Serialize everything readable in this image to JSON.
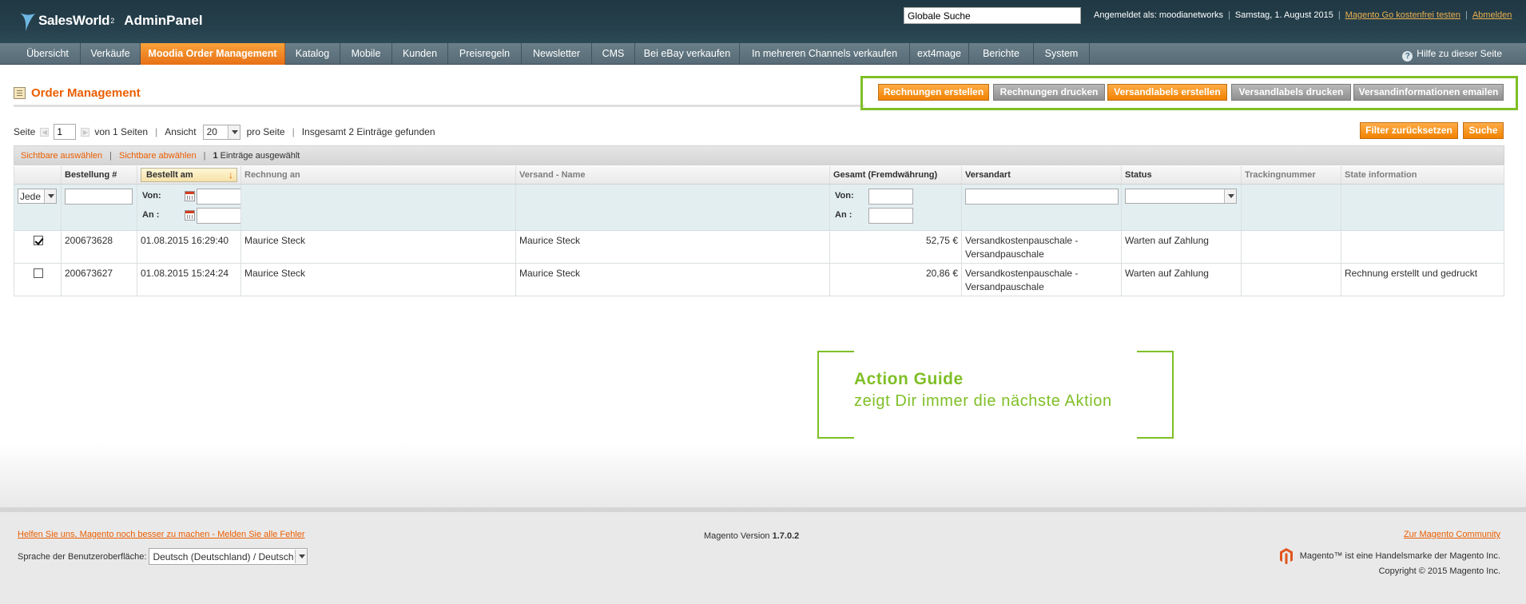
{
  "header": {
    "brand": "SalesWorld",
    "brand_sup": "2",
    "panel": "AdminPanel",
    "search_value": "Globale Suche",
    "logged_in": "Angemeldet als: moodianetworks",
    "date": "Samstag, 1. August 2015",
    "trial_link": "Magento Go kostenfrei testen",
    "logout": "Abmelden"
  },
  "nav": {
    "items": [
      "Übersicht",
      "Verkäufe",
      "Moodia Order Management",
      "Katalog",
      "Mobile",
      "Kunden",
      "Preisregeln",
      "Newsletter",
      "CMS",
      "Bei eBay verkaufen",
      "In mehreren Channels verkaufen",
      "ext4mage",
      "Berichte",
      "System"
    ],
    "active": "Moodia Order Management",
    "help": "Hilfe zu dieser Seite"
  },
  "page": {
    "title": "Order Management"
  },
  "actions": {
    "create_invoices": "Rechnungen erstellen",
    "print_invoices": "Rechnungen drucken",
    "create_labels": "Versandlabels erstellen",
    "print_labels": "Versandlabels drucken",
    "email_shipping": "Versandinformationen emailen"
  },
  "pager": {
    "page_label": "Seite",
    "page_value": "1",
    "of_pages": "von 1 Seiten",
    "view_label": "Ansicht",
    "per_page": "20",
    "per_page_label": "pro Seite",
    "total": "Insgesamt 2 Einträge gefunden",
    "reset_filter": "Filter zurücksetzen",
    "search": "Suche"
  },
  "massaction": {
    "select_visible": "Sichtbare auswählen",
    "unselect_visible": "Sichtbare abwählen",
    "selected_count": "1",
    "selected_label": "Einträge ausgewählt"
  },
  "grid": {
    "headers": {
      "order": "Bestellung #",
      "ordered_at": "Bestellt am",
      "bill_to": "Rechnung an",
      "ship_to": "Versand - Name",
      "total": "Gesamt (Fremdwährung)",
      "shipping": "Versandart",
      "status": "Status",
      "tracking": "Trackingnummer",
      "state": "State information"
    },
    "filters": {
      "any": "Jede",
      "from": "Von:",
      "to": "An :"
    },
    "rows": [
      {
        "checked": true,
        "order": "200673628",
        "ordered_at": "01.08.2015 16:29:40",
        "bill_to": "Maurice Steck",
        "ship_to": "Maurice Steck",
        "total": "52,75 €",
        "shipping": "Versandkostenpauschale - Versandpauschale",
        "status": "Warten auf Zahlung",
        "tracking": "",
        "state": ""
      },
      {
        "checked": false,
        "order": "200673627",
        "ordered_at": "01.08.2015 15:24:24",
        "bill_to": "Maurice Steck",
        "ship_to": "Maurice Steck",
        "total": "20,86 €",
        "shipping": "Versandkostenpauschale - Versandpauschale",
        "status": "Warten auf Zahlung",
        "tracking": "",
        "state": "Rechnung erstellt und gedruckt"
      }
    ]
  },
  "guide": {
    "title": "Action Guide",
    "subtitle": "zeigt Dir immer die nächste Aktion"
  },
  "footer": {
    "feedback_link": "Helfen Sie uns, Magento noch besser zu machen - Melden Sie alle Fehler",
    "language_label": "Sprache der Benutzeroberfläche:",
    "language_value": "Deutsch (Deutschland) / Deutsch",
    "version_label": "Magento Version",
    "version": "1.7.0.2",
    "community_link": "Zur Magento Community",
    "trademark": "Magento™ ist eine Handelsmarke der Magento Inc.",
    "copyright": "Copyright © 2015 Magento Inc."
  },
  "colors": {
    "accent_orange": "#eb5e00",
    "guide_green": "#7fbf26",
    "header_dark": "#253f4b"
  }
}
